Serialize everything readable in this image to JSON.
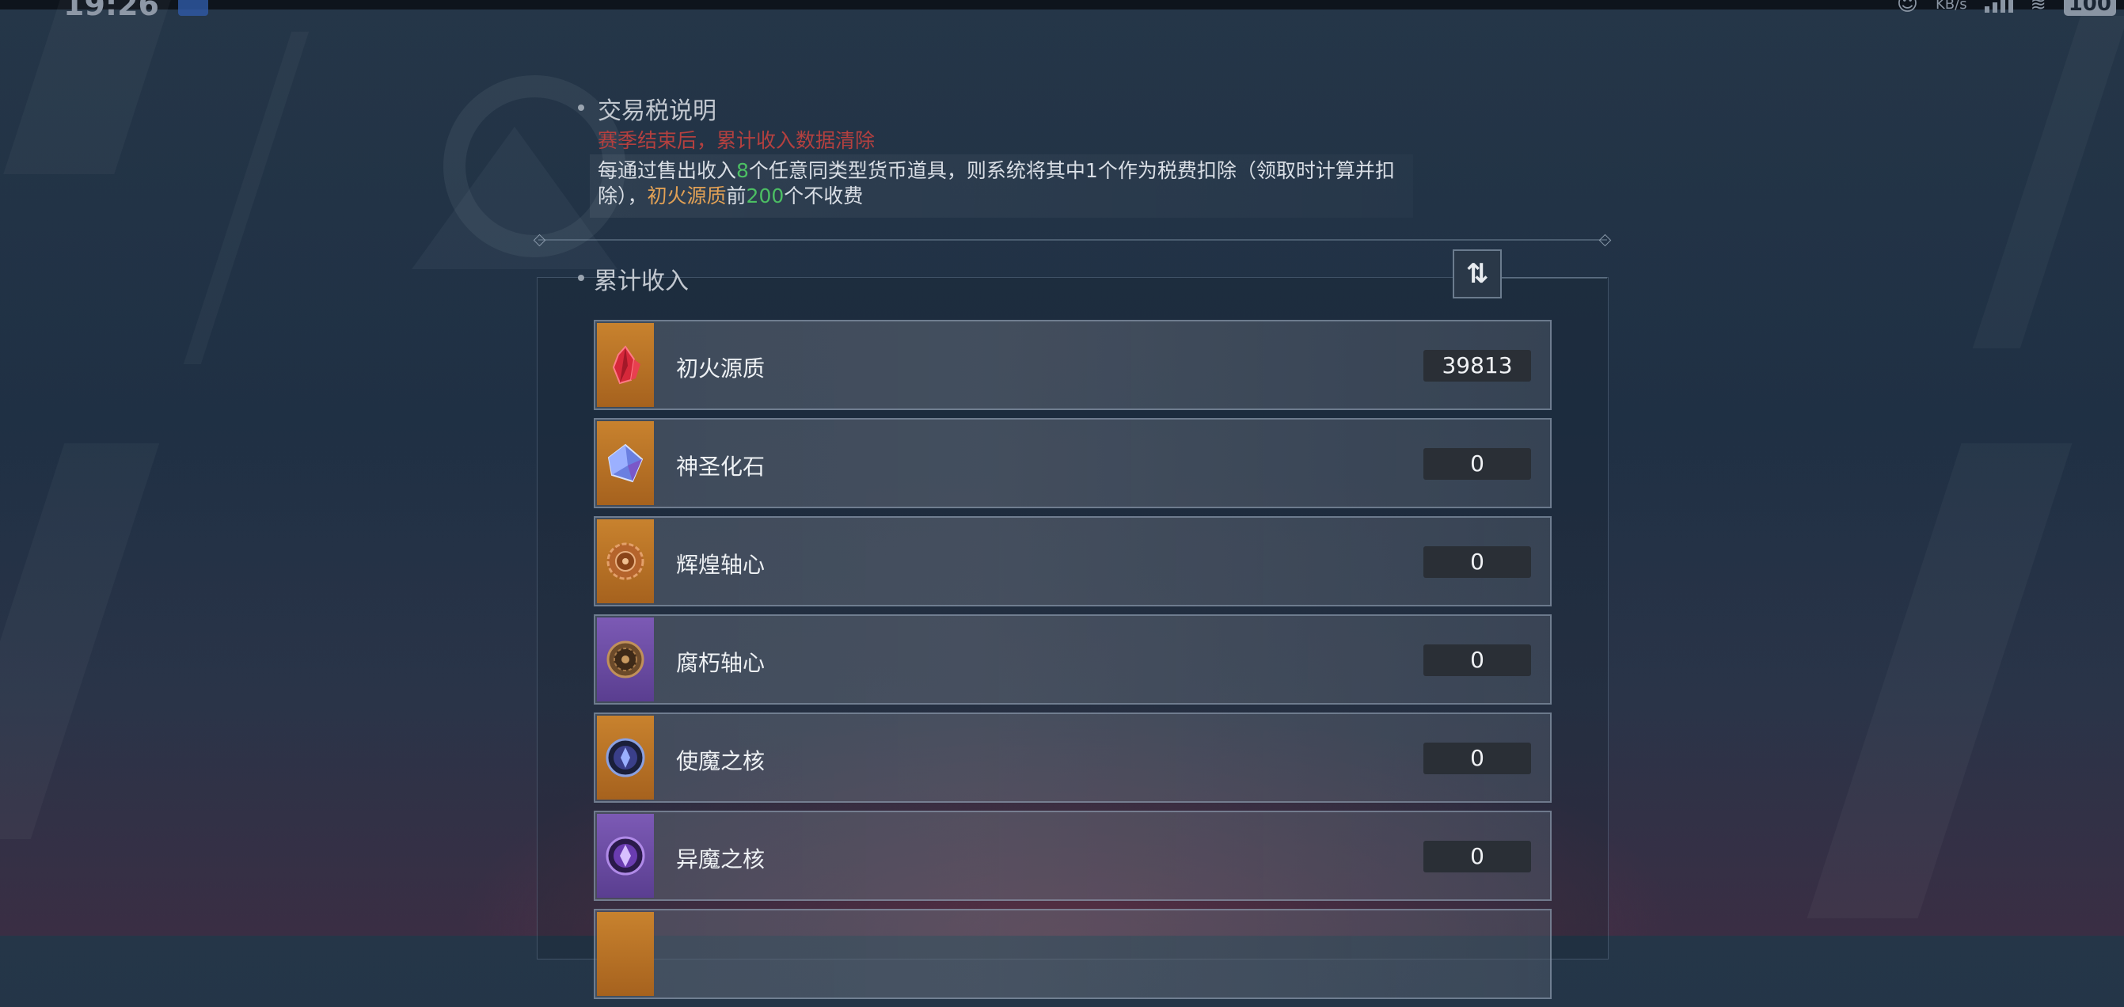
{
  "status_bar": {
    "time": "19:26",
    "net_speed_unit": "KB/s",
    "battery": "100"
  },
  "tax_section": {
    "title": "交易税说明",
    "warning": "赛季结束后，累计收入数据清除",
    "desc_part1": "每通过售出收入",
    "desc_num1": "8",
    "desc_part2": "个任意同类型货币道具，则系统将其中1个作为税费扣除（领取时计算并扣除），",
    "desc_item": "初火源质",
    "desc_part3": "前",
    "desc_num2": "200",
    "desc_part4": "个不收费"
  },
  "income_section": {
    "title": "累计收入",
    "sort_icon": "sort-toggle-icon",
    "items": [
      {
        "name": "初火源质",
        "value": "39813",
        "icon": "red-crystal-icon",
        "rarity_color": "#c8822e"
      },
      {
        "name": "神圣化石",
        "value": "0",
        "icon": "prism-gem-icon",
        "rarity_color": "#c8822e"
      },
      {
        "name": "辉煌轴心",
        "value": "0",
        "icon": "bronze-gear-icon",
        "rarity_color": "#c8822e"
      },
      {
        "name": "腐朽轴心",
        "value": "0",
        "icon": "dark-gear-icon",
        "rarity_color": "#7c5ab5"
      },
      {
        "name": "使魔之核",
        "value": "0",
        "icon": "blue-core-icon",
        "rarity_color": "#c8822e"
      },
      {
        "name": "异魔之核",
        "value": "0",
        "icon": "purple-core-icon",
        "rarity_color": "#7c5ab5"
      }
    ]
  },
  "colors": {
    "warning_red": "#b4403f",
    "highlight_green": "#4cbf63",
    "highlight_orange": "#e2a155"
  }
}
